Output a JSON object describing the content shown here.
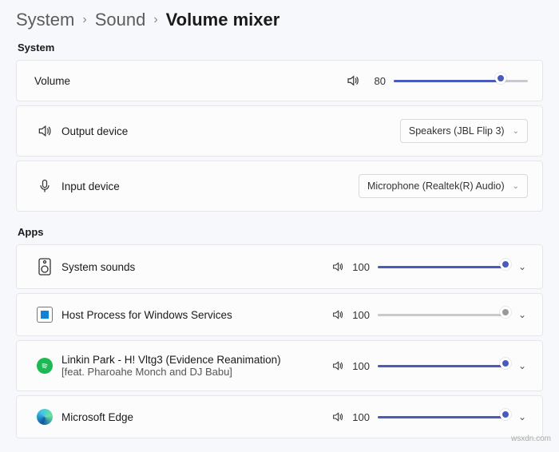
{
  "breadcrumb": {
    "root": "System",
    "mid": "Sound",
    "current": "Volume mixer"
  },
  "sections": {
    "system": "System",
    "apps": "Apps"
  },
  "volume": {
    "label": "Volume",
    "value": "80",
    "percent": 80
  },
  "output": {
    "label": "Output device",
    "selected": "Speakers (JBL Flip 3)"
  },
  "input": {
    "label": "Input device",
    "selected": "Microphone (Realtek(R) Audio)"
  },
  "apps": [
    {
      "icon": "speaker-device",
      "label": "System sounds",
      "value": "100",
      "percent": 100,
      "muted": false
    },
    {
      "icon": "host-process",
      "label": "Host Process for Windows Services",
      "value": "100",
      "percent": 100,
      "muted": true
    },
    {
      "icon": "spotify",
      "label": "Linkin Park - H! Vltg3 (Evidence Reanimation)",
      "sublabel": "[feat. Pharoahe Monch and DJ Babu]",
      "value": "100",
      "percent": 100,
      "muted": false
    },
    {
      "icon": "edge",
      "label": "Microsoft Edge",
      "value": "100",
      "percent": 100,
      "muted": false
    }
  ],
  "watermark": "wsxdn.com"
}
